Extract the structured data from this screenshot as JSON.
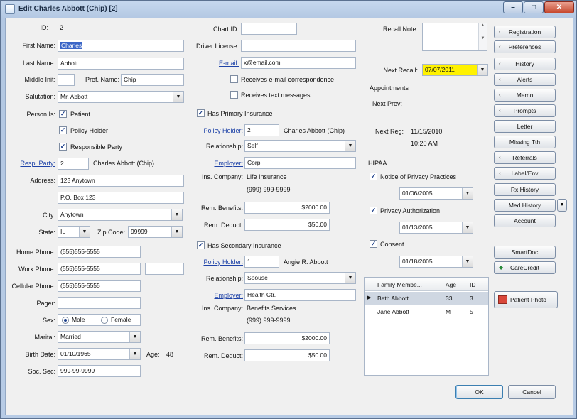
{
  "window": {
    "title": "Edit Charles Abbott (Chip) [2]",
    "minimize": "–",
    "maximize": "□",
    "close": "✕"
  },
  "left": {
    "id_label": "ID:",
    "id_value": "2",
    "first_name_label": "First Name:",
    "first_name": "Charles",
    "last_name_label": "Last Name:",
    "last_name": "Abbott",
    "middle_init_label": "Middle Init:",
    "middle_init": "",
    "pref_name_label": "Pref. Name:",
    "pref_name": "Chip",
    "salutation_label": "Salutation:",
    "salutation": "Mr. Abbott",
    "person_is_label": "Person Is:",
    "patient": "Patient",
    "policy_holder": "Policy Holder",
    "responsible_party": "Responsible Party",
    "resp_party_label": "Resp. Party:",
    "resp_party_id": "2",
    "resp_party_name": "Charles Abbott (Chip)",
    "address_label": "Address:",
    "address1": "123 Anytown",
    "address2": "P.O. Box 123",
    "city_label": "City:",
    "city": "Anytown",
    "state_label": "State:",
    "state": "IL",
    "zip_label": "Zip Code:",
    "zip": "99999",
    "home_phone_label": "Home Phone:",
    "home_phone": "(555)555-5555",
    "work_phone_label": "Work Phone:",
    "work_phone": "(555)555-5555",
    "work_ext": "",
    "cell_phone_label": "Cellular Phone:",
    "cell_phone": "(555)555-5555",
    "pager_label": "Pager:",
    "pager": "",
    "sex_label": "Sex:",
    "male": "Male",
    "female": "Female",
    "marital_label": "Marital:",
    "marital": "Married",
    "birth_date_label": "Birth Date:",
    "birth_date": "01/10/1965",
    "age_label": "Age:",
    "age": "48",
    "soc_sec_label": "Soc. Sec:",
    "soc_sec": "999-99-9999"
  },
  "middle": {
    "chart_id_label": "Chart ID:",
    "chart_id": "",
    "drivers_license_label": "Driver License:",
    "drivers_license": "",
    "email_label": "E-mail:",
    "email": "x@email.com",
    "receives_email": "Receives e-mail correspondence",
    "receives_text": "Receives text messages",
    "primary": {
      "has_label": "Has Primary Insurance",
      "policy_holder_label": "Policy Holder:",
      "policy_holder_id": "2",
      "policy_holder_name": "Charles Abbott (Chip)",
      "relationship_label": "Relationship:",
      "relationship": "Self",
      "employer_label": "Employer:",
      "employer": "Corp.",
      "ins_company_label": "Ins. Company:",
      "ins_company": "Life Insurance",
      "ins_phone": "(999) 999-9999",
      "rem_benefits_label": "Rem. Benefits:",
      "rem_benefits": "$2000.00",
      "rem_deduct_label": "Rem. Deduct:",
      "rem_deduct": "$50.00"
    },
    "secondary": {
      "has_label": "Has Secondary Insurance",
      "policy_holder_label": "Policy Holder:",
      "policy_holder_id": "1",
      "policy_holder_name": "Angie R. Abbott",
      "relationship_label": "Relationship:",
      "relationship": "Spouse",
      "employer_label": "Employer:",
      "employer": "Health Ctr.",
      "ins_company_label": "Ins. Company:",
      "ins_company": "Benefits Services",
      "ins_phone": "(999) 999-9999",
      "rem_benefits_label": "Rem. Benefits:",
      "rem_benefits": "$2000.00",
      "rem_deduct_label": "Rem. Deduct:",
      "rem_deduct": "$50.00"
    }
  },
  "right": {
    "recall_note_label": "Recall Note:",
    "recall_note": "",
    "next_recall_label": "Next Recall:",
    "next_recall": "07/07/2011",
    "appointments_label": "Appointments",
    "next_prev_label": "Next Prev:",
    "next_prev": "",
    "next_reg_label": "Next Reg:",
    "next_reg_date": "11/15/2010",
    "next_reg_time": "10:20 AM",
    "hipaa_label": "HIPAA",
    "privacy_practices": "Notice of Privacy Practices",
    "privacy_practices_date": "01/06/2005",
    "privacy_auth": "Privacy Authorization",
    "privacy_auth_date": "01/13/2005",
    "consent": "Consent",
    "consent_date": "01/18/2005",
    "family_table": {
      "headers": [
        "Family Membe...",
        "Age",
        "ID"
      ],
      "rows": [
        {
          "name": "Beth Abbott",
          "age": "33",
          "id": "3"
        },
        {
          "name": "Jane Abbott",
          "age": "M",
          "id": "5"
        }
      ]
    }
  },
  "nav": {
    "buttons": [
      "Registration",
      "Preferences",
      "History",
      "Alerts",
      "Memo",
      "Prompts",
      "Letter",
      "Missing Tth",
      "Referrals",
      "Label/Env",
      "Rx History",
      "Med History",
      "Account"
    ],
    "smartdoc": "SmartDoc",
    "carecredit": "CareCredit",
    "patient_photo": "Patient Photo"
  },
  "footer": {
    "ok": "OK",
    "cancel": "Cancel"
  }
}
